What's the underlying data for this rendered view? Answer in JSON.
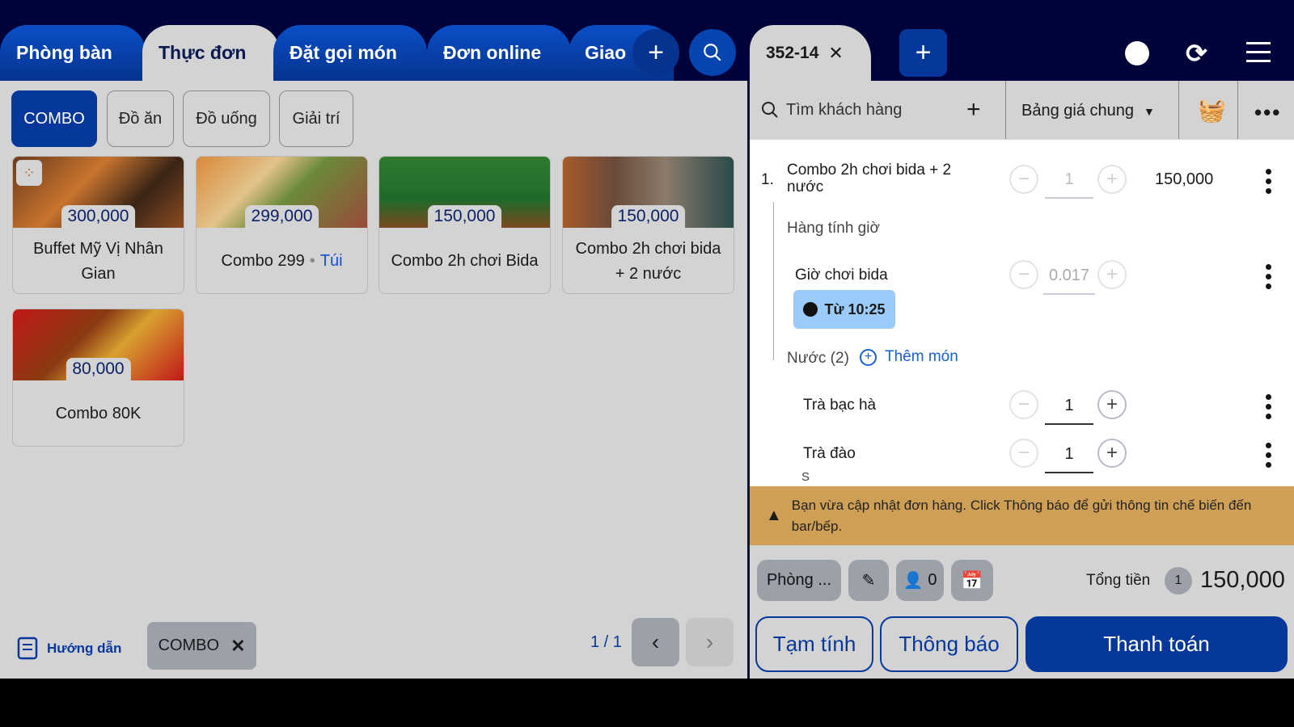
{
  "left_tabs": [
    {
      "label": "Phòng bàn"
    },
    {
      "label": "Thực đơn"
    },
    {
      "label": "Đặt gọi món"
    },
    {
      "label": "Đơn online"
    },
    {
      "label": "Giao"
    }
  ],
  "categories": [
    {
      "label": "COMBO"
    },
    {
      "label": "Đồ ăn"
    },
    {
      "label": "Đồ uống"
    },
    {
      "label": "Giải trí"
    }
  ],
  "products": [
    {
      "name": "Buffet Mỹ Vị Nhân Gian",
      "price": "300,000"
    },
    {
      "name": "Combo 299",
      "tag": "Túi",
      "price": "299,000"
    },
    {
      "name": "Combo 2h chơi Bida",
      "price": "150,000"
    },
    {
      "name": "Combo 2h chơi bida + 2 nước",
      "price": "150,000"
    },
    {
      "name": "Combo 80K",
      "price": "80,000"
    }
  ],
  "footer": {
    "guide": "Hướng dẫn",
    "filter_chip": "COMBO",
    "pager": "1 / 1"
  },
  "order_tab": {
    "label": "352-14"
  },
  "toolbar": {
    "customer_placeholder": "Tìm khách hàng",
    "price_list": "Bảng giá chung"
  },
  "order": {
    "index": "1.",
    "name": "Combo 2h chơi bida + 2 nước",
    "qty": "1",
    "price": "150,000",
    "group1": "Hàng tính giờ",
    "timed": {
      "name": "Giờ chơi bida",
      "qty": "0.017",
      "start": "Từ 10:25"
    },
    "group2": "Nước (2)",
    "add_item": "Thêm món",
    "drinks": [
      {
        "name": "Trà bạc hà",
        "qty": "1"
      },
      {
        "name": "Trà đào",
        "qty": "1",
        "note": "S"
      }
    ]
  },
  "warning": "Bạn vừa cập nhật đơn hàng. Click Thông báo để gửi thông tin chế biến đến bar/bếp.",
  "bottom": {
    "room": "Phòng ...",
    "guests": "0",
    "total_label": "Tổng tiền",
    "total_count": "1",
    "total": "150,000",
    "temp": "Tạm tính",
    "notify": "Thông báo",
    "pay": "Thanh toán"
  }
}
